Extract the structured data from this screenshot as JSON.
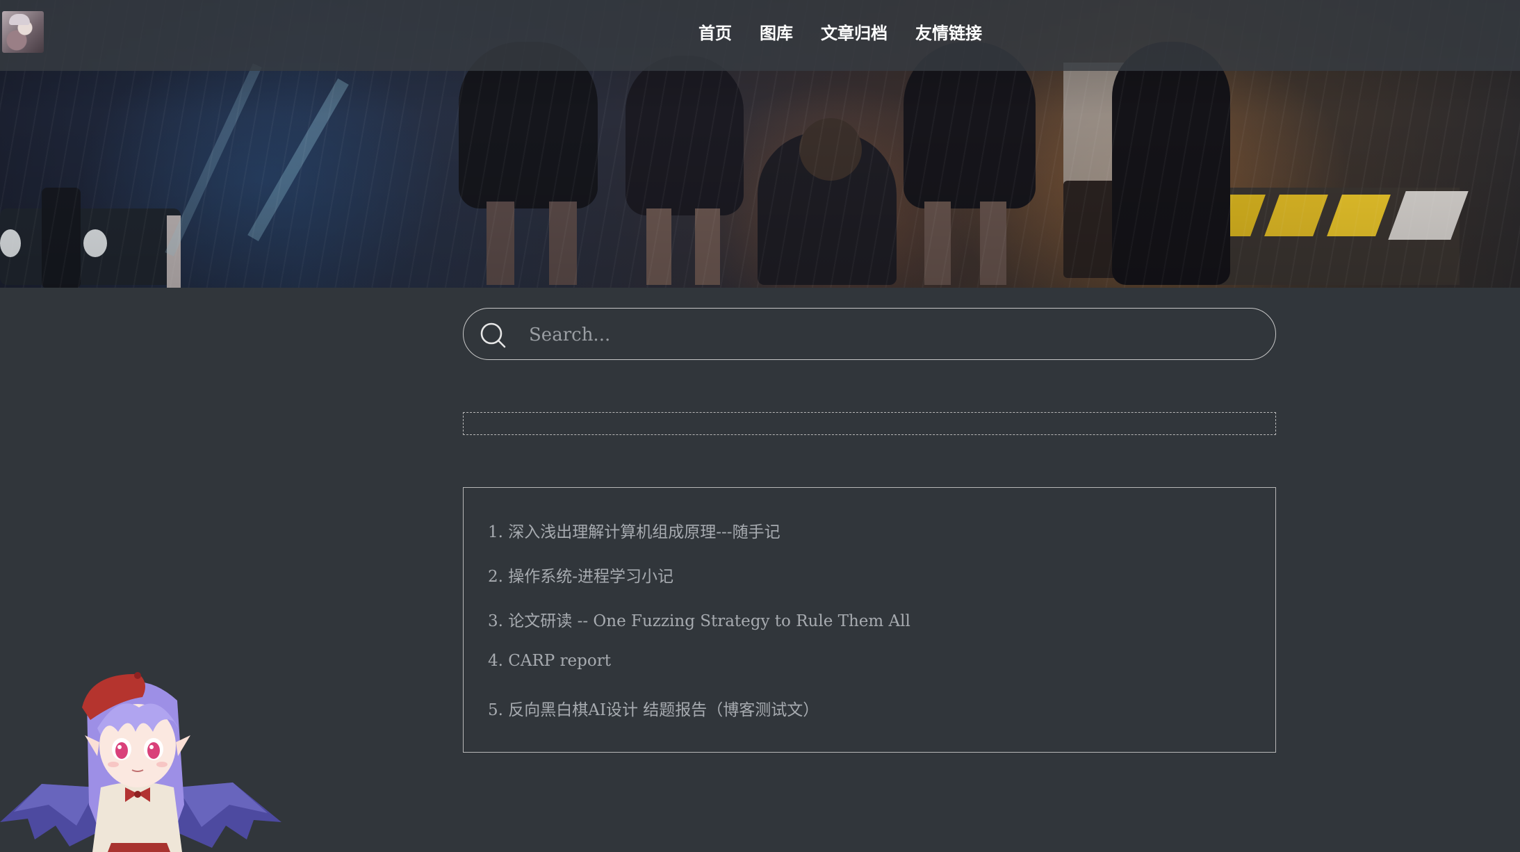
{
  "nav": {
    "items": [
      "首页",
      "图库",
      "文章归档",
      "友情链接"
    ]
  },
  "search": {
    "placeholder": "Search..."
  },
  "posts": [
    "1. 深入浅出理解计算机组成原理---随手记",
    "2. 操作系统-进程学习小记",
    "3. 论文研读 -- One Fuzzing Strategy to Rule Them All",
    "4. CARP report",
    "5. 反向黑白棋AI设计 结题报告（博客测试文）"
  ],
  "colors": {
    "page_background": "#31363b",
    "nav_text": "#ffffff",
    "post_text": "#a7abb0",
    "border": "#b8b8b8"
  },
  "icons": {
    "search": "search-icon",
    "logo": "site-logo-avatar",
    "mascot": "anime-bat-girl-mascot"
  }
}
